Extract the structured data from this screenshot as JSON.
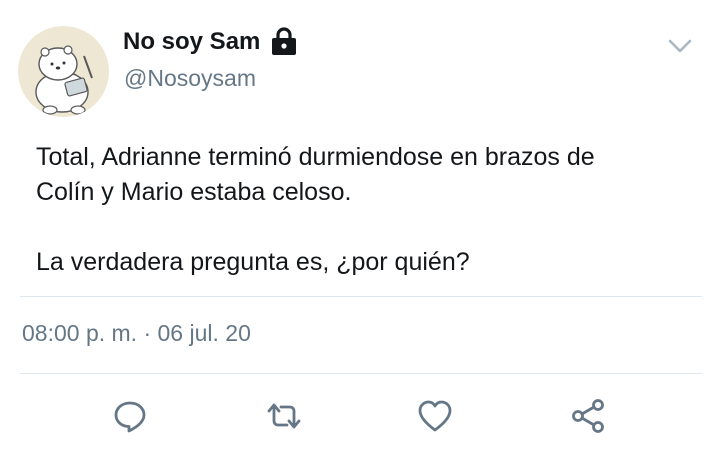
{
  "tweet": {
    "author": {
      "display_name": "No soy Sam",
      "handle": "@Nosoysam",
      "avatar_icon": "polar-bear-avatar",
      "protected_icon": "lock-icon"
    },
    "menu_icon": "chevron-down-icon",
    "body": {
      "line1": "Total, Adrianne terminó durmiendose en brazos de",
      "line2": "Colín y Mario estaba celoso.",
      "line3": "La verdadera pregunta es, ¿por quién?"
    },
    "timestamp": "08:00 p. m. · 06 jul. 20",
    "actions": [
      {
        "name": "reply",
        "icon": "reply-icon"
      },
      {
        "name": "retweet",
        "icon": "retweet-icon"
      },
      {
        "name": "like",
        "icon": "heart-icon"
      },
      {
        "name": "share",
        "icon": "share-icon"
      }
    ]
  },
  "colors": {
    "text_primary": "#14171a",
    "text_secondary": "#657786",
    "divider": "#e1e8ed",
    "icon": "#657786",
    "avatar_bg": "#ede7d4"
  }
}
